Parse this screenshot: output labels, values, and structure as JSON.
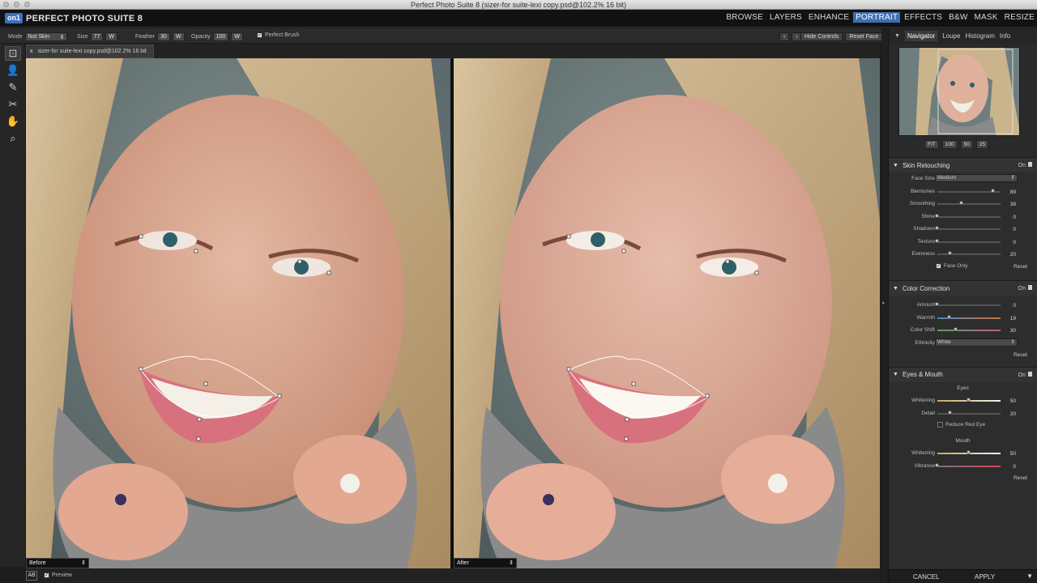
{
  "window": {
    "title": "Perfect Photo Suite 8 (sizer-for suite-lexi copy.psd@102.2% 16 bit)"
  },
  "app": {
    "logo_mark": "on1",
    "logo_text": "PERFECT PHOTO SUITE 8"
  },
  "modules": [
    "BROWSE",
    "LAYERS",
    "ENHANCE",
    "PORTRAIT",
    "EFFECTS",
    "B&W",
    "MASK",
    "RESIZE"
  ],
  "active_module": "PORTRAIT",
  "options": {
    "mode_label": "Mode",
    "mode_value": "Not Skin",
    "size_label": "Size",
    "size_value": "77",
    "feather_label": "Feather",
    "feather_value": "30",
    "opacity_label": "Opacity",
    "opacity_value": "100",
    "w_label": "W",
    "perfect_brush": "Perfect Brush",
    "hide_controls": "Hide Controls",
    "reset_face": "Reset Face"
  },
  "document": {
    "tab_close": "x",
    "tab_title": "sizer-for suite-lexi copy.psd@102.2% 16 bit"
  },
  "views": {
    "left_label": "Before",
    "right_label": "After"
  },
  "status": {
    "ab_icon": "AB",
    "preview_label": "Preview"
  },
  "panel_tabs": [
    "Navigator",
    "Loupe",
    "Histogram",
    "Info"
  ],
  "active_panel_tab": "Navigator",
  "navigator": {
    "zoom_buttons": [
      "FIT",
      "100",
      "50",
      "25"
    ]
  },
  "skin_retouching": {
    "title": "Skin Retouching",
    "on_label": "On",
    "face_size_label": "Face Size",
    "face_size_value": "Medium",
    "sliders": [
      {
        "label": "Blemishes",
        "value": "89",
        "pos": 0.89
      },
      {
        "label": "Smoothing",
        "value": "38",
        "pos": 0.38
      },
      {
        "label": "Shine",
        "value": "0",
        "pos": 0
      },
      {
        "label": "Shadows",
        "value": "0",
        "pos": 0
      },
      {
        "label": "Texture",
        "value": "0",
        "pos": 0
      },
      {
        "label": "Evenness",
        "value": "20",
        "pos": 0.2
      }
    ],
    "face_only": "Face Only",
    "reset": "Reset"
  },
  "color_correction": {
    "title": "Color Correction",
    "on_label": "On",
    "sliders": [
      {
        "label": "Amount",
        "value": "0",
        "pos": 0
      },
      {
        "label": "Warmth",
        "value": "19",
        "pos": 0.19
      },
      {
        "label": "Color Shift",
        "value": "30",
        "pos": 0.3
      }
    ],
    "ethnicity_label": "Ethnicity",
    "ethnicity_value": "White",
    "reset": "Reset"
  },
  "eyes_mouth": {
    "title": "Eyes & Mouth",
    "on_label": "On",
    "eyes_heading": "Eyes",
    "eyes_sliders": [
      {
        "label": "Whitening",
        "value": "50",
        "pos": 0.5
      },
      {
        "label": "Detail",
        "value": "20",
        "pos": 0.2
      }
    ],
    "reduce_red_eye": "Reduce Red Eye",
    "mouth_heading": "Mouth",
    "mouth_sliders": [
      {
        "label": "Whitening",
        "value": "50",
        "pos": 0.5
      },
      {
        "label": "Vibrance",
        "value": "0",
        "pos": 0
      }
    ],
    "reset": "Reset"
  },
  "footer": {
    "cancel": "CANCEL",
    "apply": "APPLY"
  },
  "colors": {
    "accent": "#3e6fb5",
    "panel_bg": "#2d2d2d",
    "warm_track": "#c9732f",
    "cool_track": "#4f7fc9"
  }
}
